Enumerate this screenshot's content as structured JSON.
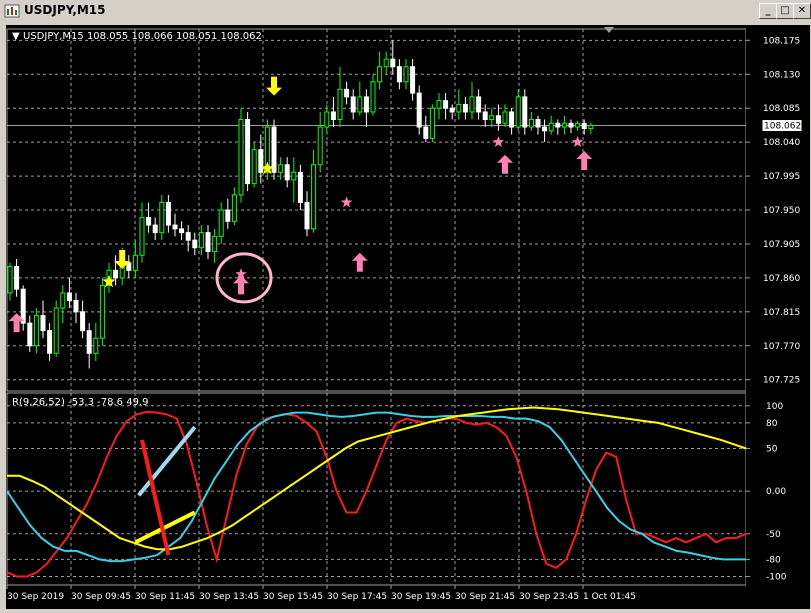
{
  "window": {
    "title": "USDJPY,M15",
    "minimize": "_",
    "restore": "□",
    "close": "✕"
  },
  "main_header": {
    "arrow": "▼",
    "text": "USDJPY,M15  108.055 108.066 108.051 108.062"
  },
  "price_label": "108.062",
  "indicator_header": "R(9,26,52) -53.3 -78.6 49.9",
  "colors": {
    "bg": "#000000",
    "grid": "#9e9e9e",
    "bull": "#00ff00",
    "bear": "#ffffff",
    "axis_text": "#ffffff",
    "yellow": "#ffff00",
    "pink": "#ff7fb1",
    "red": "#ff1a1a",
    "cyan": "#35d1e6",
    "light_blue": "#a3d8f0"
  },
  "chart_data": [
    {
      "type": "candlestick",
      "symbol": "USDJPY",
      "timeframe": "M15",
      "last_price": 108.062,
      "ylim": [
        107.71,
        108.19
      ],
      "y_ticks": [
        "108.175",
        "108.130",
        "108.085",
        "108.040",
        "107.995",
        "107.950",
        "107.905",
        "107.860",
        "107.815",
        "107.770",
        "107.725"
      ],
      "x_labels": [
        "30 Sep 2019",
        "30 Sep 09:45",
        "30 Sep 11:45",
        "30 Sep 13:45",
        "30 Sep 15:45",
        "30 Sep 17:45",
        "30 Sep 19:45",
        "30 Sep 21:45",
        "30 Sep 23:45",
        "1 Oct 01:45"
      ],
      "candles": [
        [
          107.84,
          107.875,
          107.83,
          107.88
        ],
        [
          107.875,
          107.845,
          107.835,
          107.885
        ],
        [
          107.845,
          107.8,
          107.79,
          107.85
        ],
        [
          107.8,
          107.77,
          107.762,
          107.81
        ],
        [
          107.77,
          107.81,
          107.76,
          107.82
        ],
        [
          107.81,
          107.79,
          107.78,
          107.83
        ],
        [
          107.79,
          107.76,
          107.75,
          107.8
        ],
        [
          107.76,
          107.82,
          107.755,
          107.83
        ],
        [
          107.82,
          107.84,
          107.8,
          107.85
        ],
        [
          107.84,
          107.83,
          107.82,
          107.86
        ],
        [
          107.83,
          107.815,
          107.8,
          107.84
        ],
        [
          107.815,
          107.79,
          107.78,
          107.83
        ],
        [
          107.79,
          107.76,
          107.74,
          107.8
        ],
        [
          107.76,
          107.78,
          107.75,
          107.8
        ],
        [
          107.78,
          107.85,
          107.77,
          107.86
        ],
        [
          107.85,
          107.87,
          107.84,
          107.88
        ],
        [
          107.87,
          107.86,
          107.85,
          107.89
        ],
        [
          107.86,
          107.88,
          107.85,
          107.9
        ],
        [
          107.88,
          107.87,
          107.86,
          107.89
        ],
        [
          107.87,
          107.89,
          107.86,
          107.91
        ],
        [
          107.89,
          107.94,
          107.88,
          107.96
        ],
        [
          107.94,
          107.93,
          107.92,
          107.96
        ],
        [
          107.93,
          107.92,
          107.91,
          107.94
        ],
        [
          107.92,
          107.96,
          107.91,
          107.97
        ],
        [
          107.96,
          107.93,
          107.92,
          107.97
        ],
        [
          107.93,
          107.925,
          107.915,
          107.945
        ],
        [
          107.925,
          107.92,
          107.91,
          107.935
        ],
        [
          107.92,
          107.91,
          107.895,
          107.93
        ],
        [
          107.91,
          107.9,
          107.89,
          107.92
        ],
        [
          107.9,
          107.92,
          107.89,
          107.93
        ],
        [
          107.92,
          107.895,
          107.885,
          107.93
        ],
        [
          107.895,
          107.915,
          107.88,
          107.925
        ],
        [
          107.915,
          107.95,
          107.905,
          107.96
        ],
        [
          107.95,
          107.935,
          107.925,
          107.965
        ],
        [
          107.935,
          107.97,
          107.93,
          107.98
        ],
        [
          107.97,
          108.07,
          107.96,
          108.085
        ],
        [
          108.07,
          107.985,
          107.975,
          108.08
        ],
        [
          107.985,
          108.03,
          107.98,
          108.04
        ],
        [
          108.03,
          108.0,
          107.985,
          108.05
        ],
        [
          108.0,
          108.06,
          107.99,
          108.07
        ],
        [
          108.06,
          108.0,
          107.99,
          108.07
        ],
        [
          108.0,
          108.01,
          107.99,
          108.02
        ],
        [
          108.01,
          107.99,
          107.98,
          108.02
        ],
        [
          107.99,
          108.0,
          107.96,
          108.02
        ],
        [
          108.0,
          107.96,
          107.95,
          108.01
        ],
        [
          107.96,
          107.925,
          107.915,
          107.975
        ],
        [
          107.925,
          108.01,
          107.92,
          108.03
        ],
        [
          108.01,
          108.06,
          108.0,
          108.08
        ],
        [
          108.06,
          108.08,
          108.05,
          108.09
        ],
        [
          108.08,
          108.07,
          108.06,
          108.1
        ],
        [
          108.07,
          108.11,
          108.06,
          108.14
        ],
        [
          108.11,
          108.1,
          108.09,
          108.12
        ],
        [
          108.1,
          108.08,
          108.07,
          108.11
        ],
        [
          108.08,
          108.1,
          108.075,
          108.12
        ],
        [
          108.1,
          108.08,
          108.06,
          108.11
        ],
        [
          108.08,
          108.12,
          108.075,
          108.13
        ],
        [
          108.12,
          108.14,
          108.11,
          108.16
        ],
        [
          108.14,
          108.15,
          108.13,
          108.16
        ],
        [
          108.15,
          108.14,
          108.13,
          108.175
        ],
        [
          108.14,
          108.12,
          108.11,
          108.15
        ],
        [
          108.12,
          108.14,
          108.11,
          108.15
        ],
        [
          108.14,
          108.105,
          108.095,
          108.15
        ],
        [
          108.105,
          108.06,
          108.05,
          108.115
        ],
        [
          108.06,
          108.045,
          108.04,
          108.075
        ],
        [
          108.045,
          108.085,
          108.04,
          108.09
        ],
        [
          108.085,
          108.095,
          108.07,
          108.105
        ],
        [
          108.095,
          108.085,
          108.07,
          108.105
        ],
        [
          108.085,
          108.08,
          108.07,
          108.09
        ],
        [
          108.08,
          108.09,
          108.07,
          108.11
        ],
        [
          108.09,
          108.08,
          108.07,
          108.1
        ],
        [
          108.08,
          108.1,
          108.07,
          108.12
        ],
        [
          108.1,
          108.08,
          108.07,
          108.11
        ],
        [
          108.08,
          108.07,
          108.06,
          108.09
        ],
        [
          108.07,
          108.075,
          108.06,
          108.085
        ],
        [
          108.075,
          108.065,
          108.055,
          108.09
        ],
        [
          108.065,
          108.08,
          108.06,
          108.09
        ],
        [
          108.08,
          108.06,
          108.05,
          108.085
        ],
        [
          108.06,
          108.1,
          108.055,
          108.11
        ],
        [
          108.1,
          108.06,
          108.05,
          108.11
        ],
        [
          108.06,
          108.07,
          108.055,
          108.08
        ],
        [
          108.07,
          108.06,
          108.05,
          108.075
        ],
        [
          108.06,
          108.055,
          108.04,
          108.07
        ],
        [
          108.055,
          108.065,
          108.05,
          108.075
        ],
        [
          108.065,
          108.06,
          108.05,
          108.07
        ],
        [
          108.06,
          108.065,
          108.05,
          108.075
        ],
        [
          108.065,
          108.06,
          108.052,
          108.07
        ],
        [
          108.06,
          108.065,
          108.055,
          108.068
        ],
        [
          108.065,
          108.058,
          108.05,
          108.07
        ],
        [
          108.058,
          108.062,
          108.051,
          108.066
        ]
      ],
      "annotations": {
        "yellow_down_arrows": [
          [
            17,
            107.885
          ],
          [
            40,
            108.115
          ]
        ],
        "yellow_stars": [
          [
            15,
            107.855
          ],
          [
            39,
            108.005
          ]
        ],
        "pink_up_arrows": [
          [
            1,
            107.8
          ],
          [
            35,
            107.85
          ],
          [
            53,
            107.88
          ],
          [
            75,
            108.01
          ],
          [
            87,
            108.015
          ]
        ],
        "pink_stars": [
          [
            35,
            107.865
          ],
          [
            51,
            107.96
          ],
          [
            74,
            108.04
          ],
          [
            86,
            108.04
          ]
        ],
        "circle": [
          35,
          107.86
        ]
      }
    },
    {
      "type": "line",
      "name": "R(9,26,52)",
      "ylim": [
        -110,
        115
      ],
      "y_ticks": [
        "100",
        "80",
        "50",
        "0.00",
        "-50",
        "-80",
        "-100"
      ],
      "series": [
        {
          "name": "red",
          "values": [
            -95,
            -100,
            -100,
            -95,
            -85,
            -70,
            -55,
            -35,
            -15,
            10,
            40,
            65,
            82,
            90,
            93,
            92,
            90,
            85,
            55,
            10,
            -40,
            -80,
            -30,
            20,
            55,
            75,
            85,
            88,
            90,
            88,
            80,
            70,
            40,
            0,
            -25,
            -25,
            0,
            30,
            60,
            80,
            85,
            82,
            80,
            82,
            85,
            85,
            80,
            78,
            80,
            75,
            65,
            40,
            0,
            -50,
            -85,
            -90,
            -80,
            -50,
            -10,
            25,
            45,
            40,
            -10,
            -50,
            -50,
            -55,
            -60,
            -55,
            -60,
            -55,
            -50,
            -60,
            -55,
            -55,
            -50
          ]
        },
        {
          "name": "cyan",
          "values": [
            0,
            -20,
            -40,
            -55,
            -65,
            -70,
            -70,
            -75,
            -80,
            -82,
            -82,
            -80,
            -78,
            -75,
            -65,
            -55,
            -35,
            -10,
            15,
            35,
            55,
            70,
            80,
            87,
            90,
            92,
            92,
            90,
            88,
            87,
            88,
            90,
            92,
            92,
            90,
            88,
            87,
            87,
            88,
            88,
            88,
            88,
            87,
            87,
            85,
            85,
            82,
            75,
            60,
            40,
            20,
            0,
            -20,
            -35,
            -45,
            -50,
            -60,
            -65,
            -70,
            -72,
            -75,
            -78,
            -80,
            -80,
            -80
          ]
        },
        {
          "name": "yellow",
          "values": [
            18,
            18,
            12,
            5,
            -5,
            -15,
            -25,
            -35,
            -45,
            -55,
            -60,
            -65,
            -68,
            -68,
            -65,
            -60,
            -55,
            -48,
            -40,
            -30,
            -20,
            -10,
            0,
            10,
            20,
            30,
            40,
            50,
            58,
            62,
            66,
            70,
            74,
            78,
            82,
            85,
            88,
            90,
            92,
            94,
            96,
            97,
            98,
            97,
            96,
            94,
            92,
            90,
            88,
            86,
            84,
            82,
            80,
            76,
            72,
            68,
            64,
            60,
            55,
            50
          ]
        }
      ],
      "drawn_lines": [
        {
          "color": "light_blue",
          "from": [
            19.5,
            -5
          ],
          "to": [
            28,
            75
          ]
        },
        {
          "color": "yellow",
          "from": [
            19,
            -60
          ],
          "to": [
            28,
            -25
          ]
        },
        {
          "color": "red",
          "from": [
            20,
            60
          ],
          "to": [
            24,
            -75
          ]
        }
      ]
    }
  ]
}
